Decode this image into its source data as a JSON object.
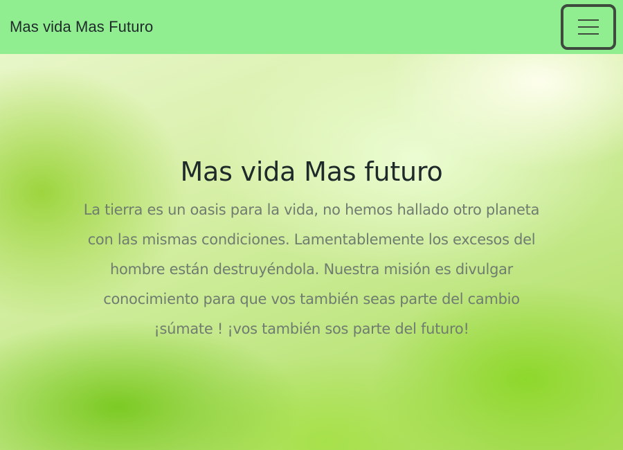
{
  "navbar": {
    "brand": "Mas vida Mas Futuro",
    "menu_icon": "hamburger-menu-icon",
    "background_color": "#90ee90"
  },
  "hero": {
    "title": "Mas vida Mas futuro",
    "text": "La tierra es un oasis para la vida, no hemos hallado otro planeta con las mismas condiciones. Lamentablemente los excesos del hombre están destruyéndola. Nuestra misión es divulgar conocimiento para que vos también seas parte del cambio ¡súmate ! ¡vos también sos parte del futuro!"
  }
}
